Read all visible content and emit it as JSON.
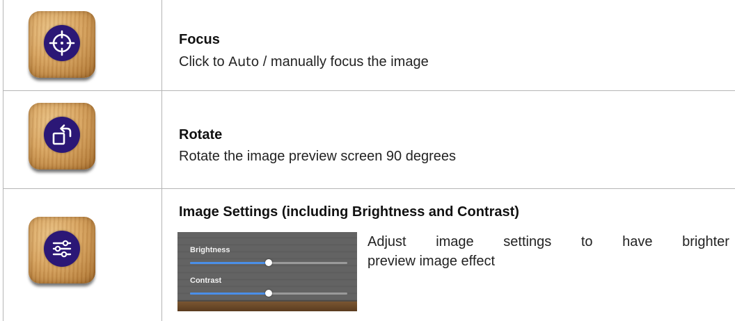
{
  "rows": [
    {
      "icon": "focus-crosshair-icon",
      "title": "Focus",
      "desc_before": "Click to ",
      "desc_highlight": "Auto",
      "desc_after": " / manually focus the image"
    },
    {
      "icon": "rotate-icon",
      "title": "Rotate",
      "desc": "Rotate the image preview screen 90 degrees"
    },
    {
      "icon": "sliders-settings-icon",
      "title": "Image Settings (including Brightness and Contrast)",
      "desc_words": [
        "Adjust",
        "image",
        "settings",
        "to",
        "have",
        "brighter"
      ],
      "desc_line2": "preview image effect",
      "preview": {
        "brightness_label": "Brightness",
        "contrast_label": "Contrast",
        "brightness_level": 0.5,
        "contrast_level": 0.5
      }
    }
  ],
  "colors": {
    "icon_disc": "#2b1776",
    "grid_line": "#b5b5b5",
    "slider_fill": "#4a8fe8"
  }
}
